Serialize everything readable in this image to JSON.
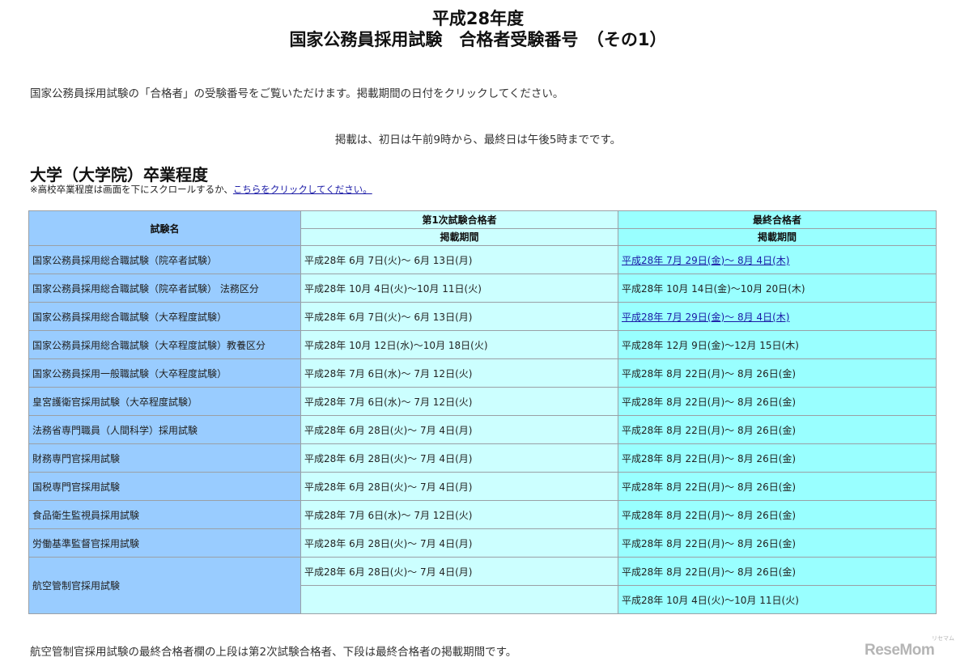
{
  "title": {
    "line1": "平成28年度",
    "line2": "国家公務員採用試験　合格者受験番号　（その1）"
  },
  "intro": "国家公務員採用試験の「合格者」の受験番号をご覧いただけます。掲載期間の日付をクリックしてください。",
  "notice": "掲載は、初日は午前9時から、最終日は午後5時までです。",
  "section": {
    "heading": "大学（大学院）卒業程度",
    "note_prefix": "※高校卒業程度は画面を下にスクロールするか、",
    "note_link": "こちらをクリックしてください。"
  },
  "table": {
    "header": {
      "name": "試験名",
      "first": "第1次試験合格者",
      "final": "最終合格者",
      "first_sub": "掲載期間",
      "final_sub": "掲載期間"
    },
    "rows": [
      {
        "name": "国家公務員採用総合職試験（院卒者試験）",
        "first": "平成28年 6月 7日(火)～ 6月 13日(月)",
        "final": "平成28年 7月 29日(金)～ 8月 4日(木)"
      },
      {
        "name": "国家公務員採用総合職試験（院卒者試験） 法務区分",
        "first": "平成28年 10月 4日(火)～10月 11日(火)",
        "final": "平成28年 10月 14日(金)～10月 20日(木)"
      },
      {
        "name": "国家公務員採用総合職試験（大卒程度試験）",
        "first": "平成28年 6月 7日(火)～ 6月 13日(月)",
        "final": "平成28年 7月 29日(金)～ 8月 4日(木)"
      },
      {
        "name": "国家公務員採用総合職試験（大卒程度試験）教養区分",
        "first": "平成28年 10月 12日(水)～10月 18日(火)",
        "final": "平成28年 12月 9日(金)～12月 15日(木)"
      },
      {
        "name": "国家公務員採用一般職試験（大卒程度試験）",
        "first": "平成28年 7月 6日(水)～ 7月 12日(火)",
        "final": "平成28年 8月 22日(月)～ 8月 26日(金)"
      },
      {
        "name": "皇宮護衛官採用試験（大卒程度試験）",
        "first": "平成28年 7月 6日(水)～ 7月 12日(火)",
        "final": "平成28年 8月 22日(月)～ 8月 26日(金)"
      },
      {
        "name": "法務省専門職員（人間科学）採用試験",
        "first": "平成28年 6月 28日(火)～ 7月 4日(月)",
        "final": "平成28年 8月 22日(月)～ 8月 26日(金)"
      },
      {
        "name": "財務専門官採用試験",
        "first": "平成28年 6月 28日(火)～ 7月 4日(月)",
        "final": "平成28年 8月 22日(月)～ 8月 26日(金)"
      },
      {
        "name": "国税専門官採用試験",
        "first": "平成28年 6月 28日(火)～ 7月 4日(月)",
        "final": "平成28年 8月 22日(月)～ 8月 26日(金)"
      },
      {
        "name": "食品衛生監視員採用試験",
        "first": "平成28年 7月 6日(水)～ 7月 12日(火)",
        "final": "平成28年 8月 22日(月)～ 8月 26日(金)"
      },
      {
        "name": "労働基準監督官採用試験",
        "first": "平成28年 6月 28日(火)～ 7月 4日(月)",
        "final": "平成28年 8月 22日(月)～ 8月 26日(金)"
      }
    ],
    "last_row": {
      "name": "航空管制官採用試験",
      "first": "平成28年 6月 28日(火)～ 7月 4日(月)",
      "first_lower": "",
      "final_upper": "平成28年 8月 22日(月)～ 8月 26日(金)",
      "final_lower": "平成28年 10月 4日(火)～10月 11日(火)"
    }
  },
  "footnote": "航空管制官採用試験の最終合格者欄の上段は第2次試験合格者、下段は最終合格者の掲載期間です。",
  "watermark": {
    "text": "ReseMom",
    "mark": "リセマム"
  }
}
